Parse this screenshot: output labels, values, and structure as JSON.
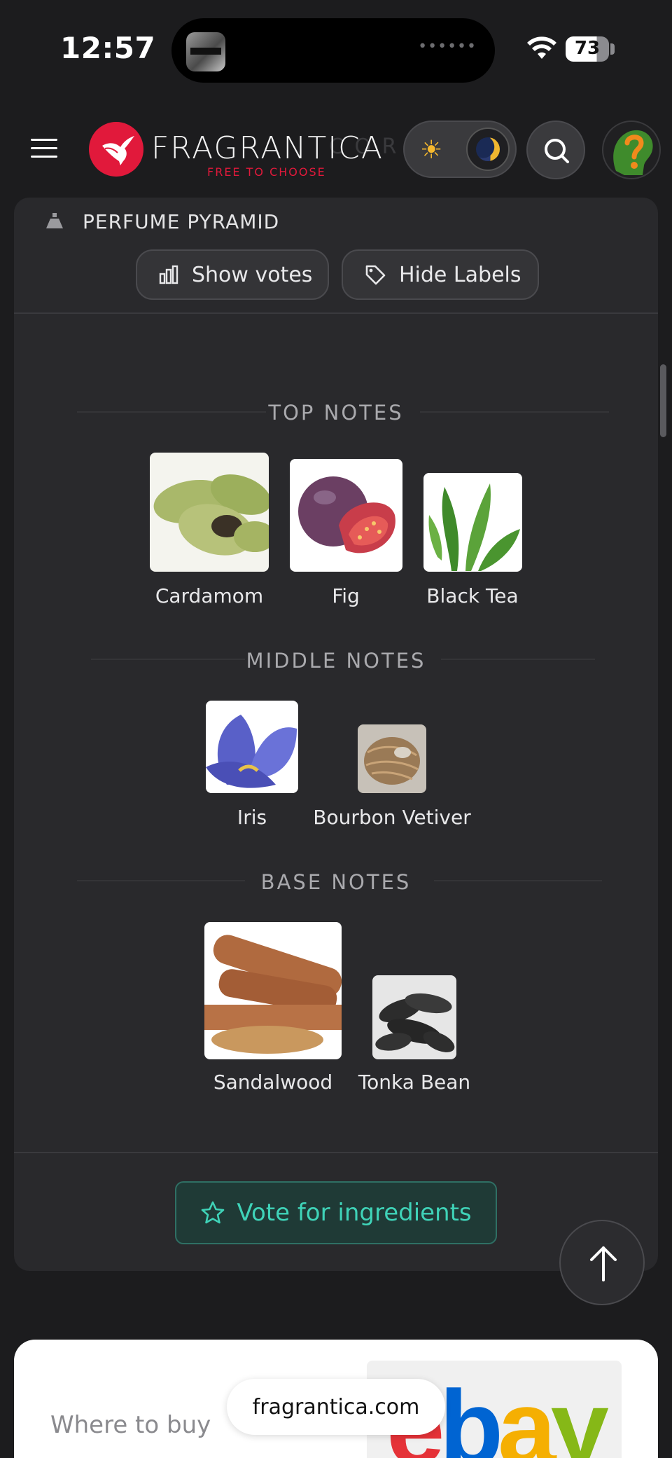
{
  "status": {
    "time": "12:57",
    "battery": "73"
  },
  "header": {
    "logo_text": "FRAGRANTICA",
    "logo_tagline": "FREE TO CHOOSE",
    "ghost_text": "C O R P O"
  },
  "pyramid": {
    "title": "PERFUME PYRAMID",
    "show_votes_label": "Show votes",
    "hide_labels_label": "Hide Labels",
    "sections": {
      "top": {
        "title": "TOP NOTES",
        "notes": [
          {
            "name": "Cardamom",
            "image": "cardamom-photo"
          },
          {
            "name": "Fig",
            "image": "fig-photo"
          },
          {
            "name": "Black Tea",
            "image": "tea-leaves-photo"
          }
        ]
      },
      "middle": {
        "title": "MIDDLE NOTES",
        "notes": [
          {
            "name": "Iris",
            "image": "iris-flower-photo"
          },
          {
            "name": "Bourbon Vetiver",
            "image": "vetiver-root-photo"
          }
        ]
      },
      "base": {
        "title": "BASE NOTES",
        "notes": [
          {
            "name": "Sandalwood",
            "image": "sandalwood-sticks-photo"
          },
          {
            "name": "Tonka Bean",
            "image": "tonka-beans-photo"
          }
        ]
      }
    },
    "vote_label": "Vote for ingredients"
  },
  "buy": {
    "where_to_buy": "Where to buy",
    "url": "fragrantica.com",
    "ebay": {
      "letters": [
        "e",
        "b",
        "a",
        "y"
      ],
      "colors": [
        "#e53238",
        "#0064d2",
        "#f5af02",
        "#86b817"
      ]
    }
  },
  "colors": {
    "accent_teal": "#3fd3b8",
    "brand_red": "#e1193b",
    "background": "#1c1c1e",
    "card": "#29292c"
  }
}
